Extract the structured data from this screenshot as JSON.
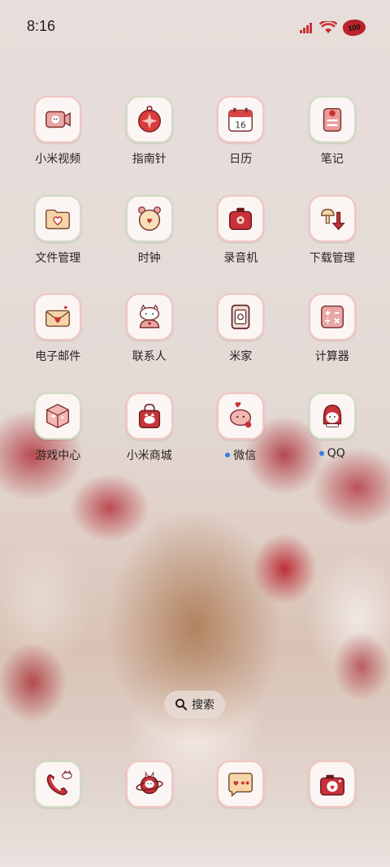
{
  "status_bar": {
    "time": "8:16",
    "battery": "100"
  },
  "apps": [
    {
      "label": "小米视频",
      "icon": "video-camera-icon"
    },
    {
      "label": "指南针",
      "icon": "compass-icon"
    },
    {
      "label": "日历",
      "icon": "calendar-icon",
      "date": "16"
    },
    {
      "label": "笔记",
      "icon": "notes-icon"
    },
    {
      "label": "文件管理",
      "icon": "folder-heart-icon"
    },
    {
      "label": "时钟",
      "icon": "alarm-clock-icon"
    },
    {
      "label": "录音机",
      "icon": "recorder-icon"
    },
    {
      "label": "下载管理",
      "icon": "download-arrow-icon"
    },
    {
      "label": "电子邮件",
      "icon": "envelope-icon"
    },
    {
      "label": "联系人",
      "icon": "cat-contact-icon"
    },
    {
      "label": "米家",
      "icon": "smart-home-icon"
    },
    {
      "label": "计算器",
      "icon": "calculator-icon"
    },
    {
      "label": "游戏中心",
      "icon": "game-cube-icon"
    },
    {
      "label": "小米商城",
      "icon": "shopping-bag-icon"
    },
    {
      "label": "微信",
      "icon": "wechat-icon",
      "notification_dot": true
    },
    {
      "label": "QQ",
      "icon": "qq-penguin-icon",
      "notification_dot": true
    }
  ],
  "search": {
    "label": "搜索"
  },
  "dock": [
    {
      "icon": "phone-icon"
    },
    {
      "icon": "browser-planet-icon"
    },
    {
      "icon": "messages-icon"
    },
    {
      "icon": "camera-icon"
    }
  ],
  "colors": {
    "accent_red": "#c8323a",
    "icon_border": "#f1c6c3",
    "notification_dot": "#3b7be8"
  }
}
